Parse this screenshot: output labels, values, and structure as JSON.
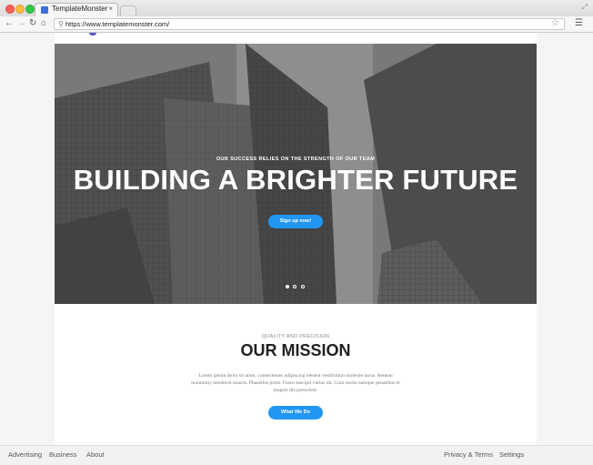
{
  "browser": {
    "tab_title": "TemplateMonster",
    "tab_close": "×",
    "url": "https://www.templatemonster.com/",
    "icons": [
      "back-arrow-icon",
      "forward-arrow-icon",
      "reload-icon",
      "home-icon",
      "search-icon",
      "star-icon",
      "menu-icon",
      "resize-icon"
    ]
  },
  "hero": {
    "eyebrow": "OUR SUCCESS RELIES ON THE STRENGTH OF OUR TEAM",
    "title": "BUILDING A BRIGHTER FUTURE",
    "cta_label": "Sign up now!",
    "slide_count": 3,
    "active_slide": 1
  },
  "mission": {
    "eyebrow": "QUALITY AND PRECISION",
    "title": "OUR MISSION",
    "body": "Lorem ipsum dolor sit amet, consectetuer adipiscing elesent vestibulum molestie lacus. Aenean nonummy hendrerit mauris. Phasellus porta. Fusce suscipit varius mi. Cum sociis natoque penatibus et magnis dis parturient.",
    "cta_label": "What We Do"
  },
  "footer": {
    "left_links": [
      "Advertising",
      "Business",
      "About"
    ],
    "right_links": [
      "Privacy & Terms",
      "Settings"
    ]
  },
  "colors": {
    "accent": "#2196f3",
    "tab_favicon": "#3d6fd8"
  }
}
